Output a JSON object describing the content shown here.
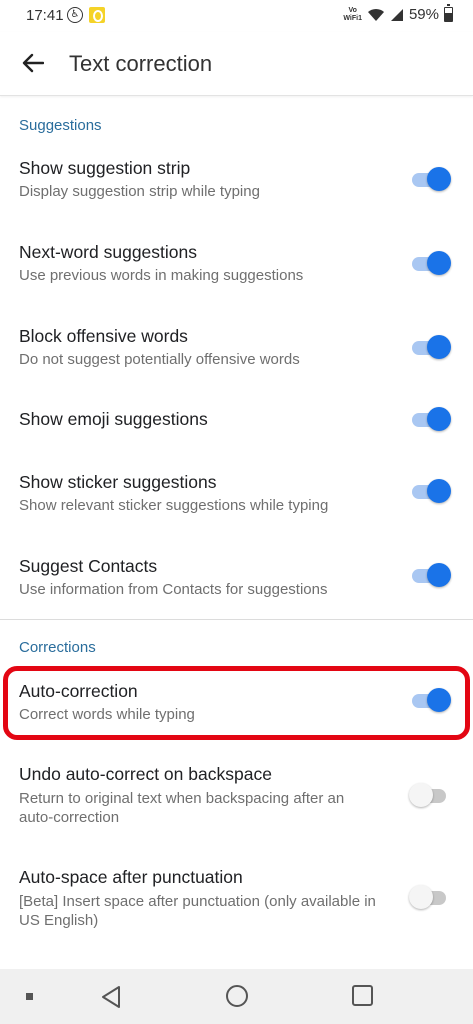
{
  "status_bar": {
    "time": "17:41",
    "network_label_line1": "Vo",
    "network_label_line2": "WiFi1",
    "battery_percent": "59%",
    "battery_level": 0.59,
    "icons": [
      "accessibility-icon",
      "notification-icon",
      "wifi-icon",
      "signal-icon",
      "battery-icon"
    ]
  },
  "app_bar": {
    "title": "Text correction",
    "back_icon": "arrow-left-icon"
  },
  "sections": {
    "suggestions": {
      "header": "Suggestions",
      "items": [
        {
          "title": "Show suggestion strip",
          "summary": "Display suggestion strip while typing",
          "enabled": true
        },
        {
          "title": "Next-word suggestions",
          "summary": "Use previous words in making suggestions",
          "enabled": true
        },
        {
          "title": "Block offensive words",
          "summary": "Do not suggest potentially offensive words",
          "enabled": true
        },
        {
          "title": "Show emoji suggestions",
          "summary": "",
          "enabled": true
        },
        {
          "title": "Show sticker suggestions",
          "summary": "Show relevant sticker suggestions while typing",
          "enabled": true
        },
        {
          "title": "Suggest Contacts",
          "summary": "Use information from Contacts for suggestions",
          "enabled": true
        }
      ]
    },
    "corrections": {
      "header": "Corrections",
      "items": [
        {
          "title": "Auto-correction",
          "summary": "Correct words while typing",
          "enabled": true,
          "highlighted": true
        },
        {
          "title": "Undo auto-correct on backspace",
          "summary": "Return to original text when backspacing after an auto-correction",
          "enabled": false
        },
        {
          "title": "Auto-space after punctuation",
          "summary": "[Beta] Insert space after punctuation (only available in US English)",
          "enabled": false
        }
      ]
    }
  },
  "colors": {
    "accent": "#1a73e8",
    "section_header": "#2a6d9c",
    "highlight_border": "#e30613"
  },
  "nav_bar": {
    "icons": [
      "menu-dot-icon",
      "back-triangle-icon",
      "home-circle-icon",
      "recents-square-icon"
    ]
  }
}
